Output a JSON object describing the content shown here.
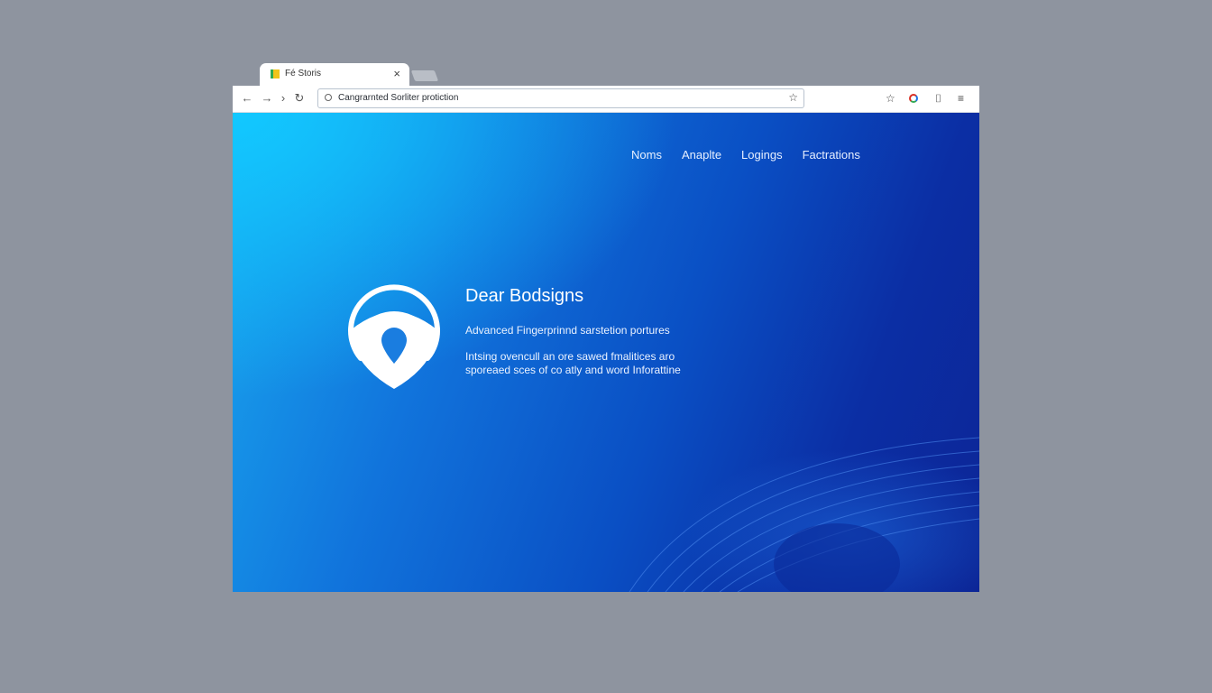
{
  "browser": {
    "tab": {
      "title": "Fé Storis",
      "close_glyph": "×",
      "favicon": "site-favicon"
    },
    "toolbar": {
      "back_glyph": "←",
      "forward_glyph": "→",
      "forward2_glyph": "›",
      "reload_glyph": "↻",
      "url": "Cangrarnted Sorliter protiction",
      "addr_star_glyph": "☆",
      "bookmark_glyph": "☆",
      "extension_glyph": "⌷",
      "menu_glyph": "≡"
    }
  },
  "page": {
    "nav": [
      "Noms",
      "Anaplte",
      "Logings",
      "Factrations"
    ],
    "hero": {
      "title": "Dear Bodsigns",
      "subtitle": "Advanced Fingerprinnd sarstetion portures",
      "desc_line1": "Intsing ovencull an ore sawed fmalitices aro",
      "desc_line2": "sporeaed sces of co atly and word Inforattine"
    },
    "logo_icon": "shield-location-icon",
    "colors": {
      "bg_light": "#12c8ff",
      "bg_mid": "#0a4fc4",
      "bg_dark": "#0c2596"
    }
  }
}
